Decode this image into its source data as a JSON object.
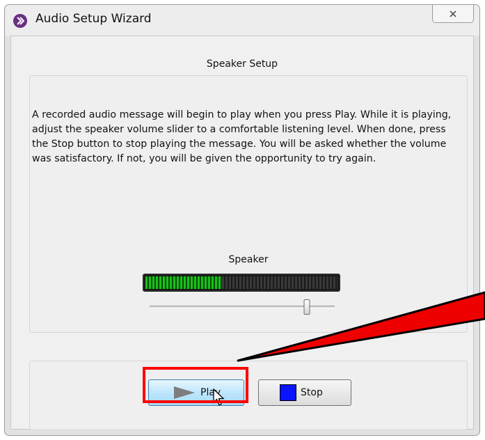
{
  "window": {
    "title": "Audio Setup Wizard",
    "app_icon": "wizard-arrow-icon",
    "close_icon": "close-icon"
  },
  "section": {
    "title": "Speaker Setup"
  },
  "instructions": {
    "text": "A recorded audio message will begin to play when you press Play. While it is playing, adjust the speaker volume slider to a comfortable listening level. When done, press the Stop button to stop playing the message. You will be asked whether the volume was satisfactory. If not, you will be given the opportunity to try again."
  },
  "speaker": {
    "label": "Speaker",
    "level_fraction": 0.4,
    "volume_fraction": 0.85
  },
  "buttons": {
    "play_label": "Play",
    "stop_label": "Stop",
    "play_icon": "play-triangle-icon",
    "stop_icon": "stop-square-icon"
  },
  "colors": {
    "highlight": "#ff0000",
    "meter_on": "#19c019",
    "stop_square": "#0a14ff",
    "app_icon": "#6a2e82"
  }
}
